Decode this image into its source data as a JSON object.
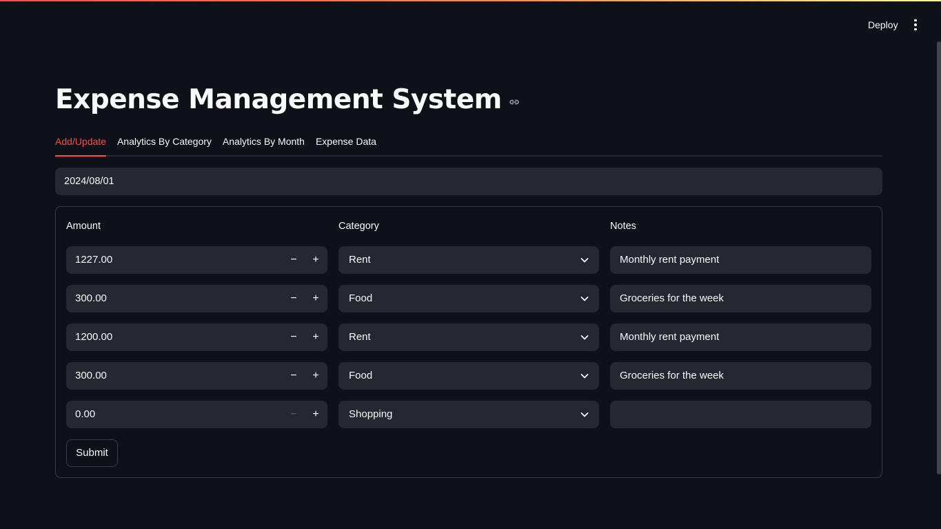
{
  "header": {
    "deploy_label": "Deploy",
    "menu_icon": "vertical-ellipsis-icon"
  },
  "page": {
    "title": "Expense Management System",
    "title_link_icon": "link-icon"
  },
  "tabs": [
    {
      "label": "Add/Update",
      "active": true
    },
    {
      "label": "Analytics By Category",
      "active": false
    },
    {
      "label": "Analytics By Month",
      "active": false
    },
    {
      "label": "Expense Data",
      "active": false
    }
  ],
  "date_input": {
    "value": "2024/08/01"
  },
  "form": {
    "columns": {
      "amount": "Amount",
      "category": "Category",
      "notes": "Notes"
    },
    "rows": [
      {
        "amount": "1227.00",
        "category": "Rent",
        "notes": "Monthly rent payment"
      },
      {
        "amount": "300.00",
        "category": "Food",
        "notes": "Groceries for the week"
      },
      {
        "amount": "1200.00",
        "category": "Rent",
        "notes": "Monthly rent payment"
      },
      {
        "amount": "300.00",
        "category": "Food",
        "notes": "Groceries for the week"
      },
      {
        "amount": "0.00",
        "category": "Shopping",
        "notes": ""
      }
    ],
    "stepper": {
      "minus": "−",
      "plus": "+"
    },
    "submit_label": "Submit"
  },
  "colors": {
    "background": "#0e1117",
    "field": "#262730",
    "accent": "#ff4b4b",
    "text": "#fafafa"
  }
}
